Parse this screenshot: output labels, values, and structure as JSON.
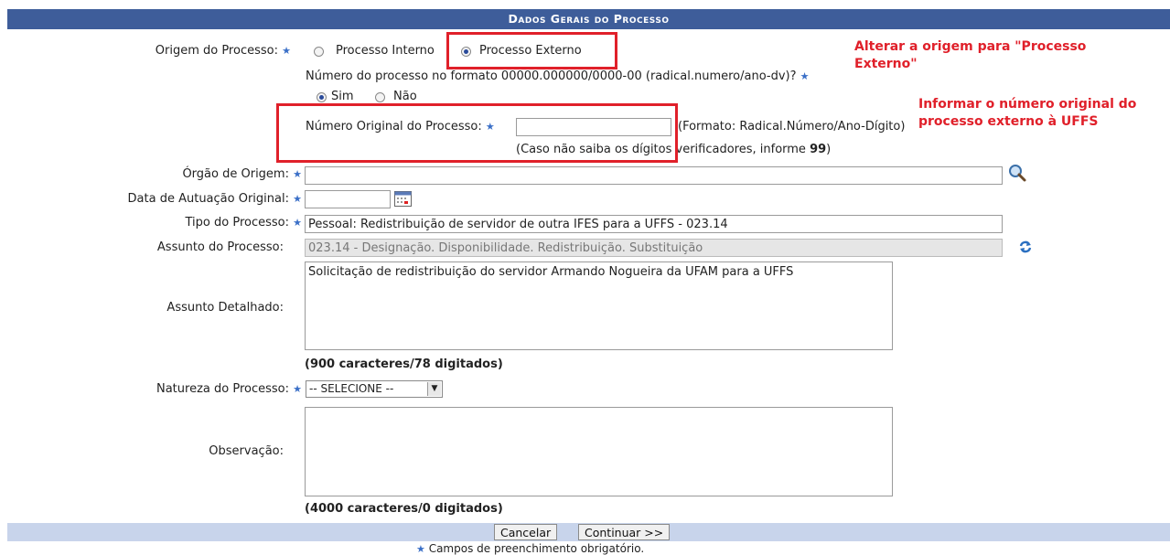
{
  "header": {
    "title": "Dados Gerais do Processo"
  },
  "origem": {
    "label": "Origem do Processo:",
    "option_interno": "Processo Interno",
    "option_externo": "Processo Externo",
    "selected": "Processo Externo"
  },
  "formato": {
    "question": "Número do processo no formato 00000.000000/0000-00 (radical.numero/ano-dv)?",
    "sim": "Sim",
    "nao": "Não",
    "selected": "Sim"
  },
  "numero_original": {
    "label": "Número Original do Processo:",
    "value": "",
    "format_hint": "(Formato: Radical.Número/Ano-Dígito)",
    "help_prefix": "(Caso não saiba os dígitos verificadores, informe ",
    "help_value": "99",
    "help_suffix": ")"
  },
  "orgao_origem": {
    "label": "Órgão de Origem:",
    "value": ""
  },
  "data_autuacao": {
    "label": "Data de Autuação Original:",
    "value": ""
  },
  "tipo_processo": {
    "label": "Tipo do Processo:",
    "value": "Pessoal: Redistribuição de servidor de outra IFES para a UFFS - 023.14"
  },
  "assunto_processo": {
    "label": "Assunto do Processo:",
    "value": "023.14 - Designação. Disponibilidade. Redistribuição. Substituição"
  },
  "assunto_detalhado": {
    "label": "Assunto Detalhado:",
    "value": "Solicitação de redistribuição do servidor Armando Nogueira da UFAM para a UFFS",
    "counter": "(900 caracteres/78 digitados)"
  },
  "natureza": {
    "label": "Natureza do Processo:",
    "selected": "-- SELECIONE --"
  },
  "observacao": {
    "label": "Observação:",
    "value": "",
    "counter": "(4000 caracteres/0 digitados)"
  },
  "buttons": {
    "cancel": "Cancelar",
    "continue": "Continuar >>"
  },
  "legend": {
    "required": "Campos de preenchimento obrigatório."
  },
  "annotations": {
    "origem_note": "Alterar a origem para \"Processo Externo\"",
    "numero_note": "Informar o número original do processo externo à UFFS"
  },
  "colors": {
    "header": "#3e5d9a",
    "annotation": "#e0202a",
    "required_star": "#3a6fc7",
    "footer": "#c8d4eb"
  }
}
